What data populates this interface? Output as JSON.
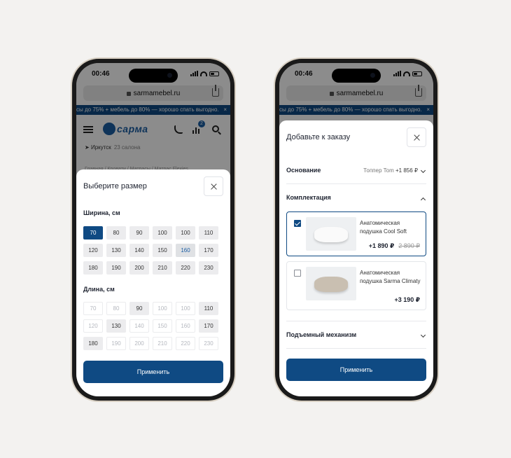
{
  "status_time": "00:46",
  "browser": {
    "url": "sarmamebel.ru"
  },
  "promo_banner": "сы до 75% + мебель до 80% — хорошо спать выгодно.",
  "promo_close": "×",
  "site": {
    "logo": "сарма",
    "cart_count": "2",
    "city": "Иркутск",
    "city_sub": "23 салона",
    "breadcrumbs": "Главная  /  Кровати  /  Матрасы  /  Матрас Flexies"
  },
  "size_sheet": {
    "title": "Выберите размер",
    "width_label": "Ширина, см",
    "widths": [
      {
        "v": "70",
        "s": "sel"
      },
      {
        "v": "80",
        "s": "avail"
      },
      {
        "v": "90",
        "s": "avail"
      },
      {
        "v": "100",
        "s": "avail"
      },
      {
        "v": "100",
        "s": "avail"
      },
      {
        "v": "110",
        "s": "avail"
      },
      {
        "v": "120",
        "s": "avail"
      },
      {
        "v": "130",
        "s": "avail"
      },
      {
        "v": "140",
        "s": "avail"
      },
      {
        "v": "150",
        "s": "avail"
      },
      {
        "v": "160",
        "s": "hl"
      },
      {
        "v": "170",
        "s": "avail"
      },
      {
        "v": "180",
        "s": "avail"
      },
      {
        "v": "190",
        "s": "avail"
      },
      {
        "v": "200",
        "s": "avail"
      },
      {
        "v": "210",
        "s": "avail"
      },
      {
        "v": "220",
        "s": "avail"
      },
      {
        "v": "230",
        "s": "avail"
      }
    ],
    "length_label": "Длина, см",
    "lengths": [
      {
        "v": "70",
        "s": "dis"
      },
      {
        "v": "80",
        "s": "dis"
      },
      {
        "v": "90",
        "s": "avail"
      },
      {
        "v": "100",
        "s": "dis"
      },
      {
        "v": "100",
        "s": "dis"
      },
      {
        "v": "110",
        "s": "avail"
      },
      {
        "v": "120",
        "s": "dis"
      },
      {
        "v": "130",
        "s": "avail"
      },
      {
        "v": "140",
        "s": "dis"
      },
      {
        "v": "150",
        "s": "dis"
      },
      {
        "v": "160",
        "s": "dis"
      },
      {
        "v": "170",
        "s": "avail"
      },
      {
        "v": "180",
        "s": "avail"
      },
      {
        "v": "190",
        "s": "dis"
      },
      {
        "v": "200",
        "s": "dis"
      },
      {
        "v": "210",
        "s": "dis"
      },
      {
        "v": "220",
        "s": "dis"
      },
      {
        "v": "230",
        "s": "dis"
      }
    ],
    "apply_label": "Применить"
  },
  "order_sheet": {
    "title": "Добавьте к заказу",
    "base_label": "Основание",
    "base_value": "Топпер Tom",
    "base_price": "+1 856 ₽",
    "kit_label": "Комплектация",
    "products": [
      {
        "name": "Анатомическая подушка Cool Soft",
        "price": "+1 890 ₽",
        "old_price": "2 890 ₽",
        "checked": true,
        "color": "white"
      },
      {
        "name": "Анатомическая подушка Sarma Climaty",
        "price": "+3 190 ₽",
        "old_price": "",
        "checked": false,
        "color": "beige"
      }
    ],
    "lift_label": "Подъемный механизм",
    "apply_label": "Применить"
  }
}
